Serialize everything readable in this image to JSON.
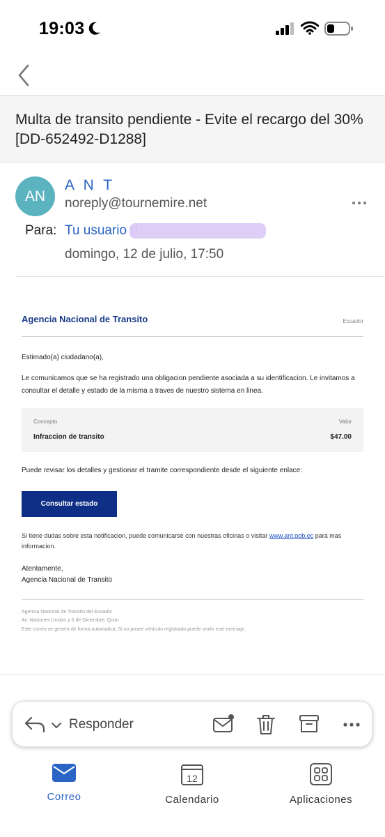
{
  "status_bar": {
    "time": "19:03"
  },
  "subject": "Multa de transito pendiente - Evite el recargo del 30% [DD-652492-D1288]",
  "header": {
    "avatar_initials": "AN",
    "avatar_color": "#5bb3bf",
    "sender_name": "A N T",
    "sender_email": "noreply@tournemire.net",
    "to_label": "Para:",
    "to_value": "Tu usuario d",
    "date": "domingo, 12 de julio, 17:50"
  },
  "email": {
    "agency": "Agencia Nacional de Transito",
    "country": "Ecuador",
    "greeting": "Estimado(a) ciudadano(a),",
    "intro": "Le comunicamos que se ha registrado una obligacion pendiente asociada a su identificacion. Le invitamos a consultar el detalle y estado de la misma a traves de nuestro sistema en linea.",
    "table": {
      "col1_header": "Concepto",
      "col2_header": "Valor",
      "col1_value": "Infraccion de transito",
      "col2_value": "$47.00"
    },
    "link_text": "Puede revisar los detalles y gestionar el tramite correspondiente desde el siguiente enlace:",
    "button": "Consultar estado",
    "doubt_prefix": "Si tiene dudas sobre esta notificacion, puede comunicarse con nuestras oficinas o visitar ",
    "doubt_link": "www.ant.gob.ec",
    "doubt_suffix": " para mas informacion.",
    "sign_off": "Atentamente,",
    "signature": "Agencia Nacional de Transito",
    "footer_1": "Agencia Nacional de Transito del Ecuador",
    "footer_2": "Av. Naciones Unidas y 6 de Diciembre, Quito",
    "footer_3": "Este correo se genera de forma automatica. Si no posee vehiculo registrado puede omitir este mensaje."
  },
  "action_bar": {
    "reply_label": "Responder"
  },
  "tabs": {
    "mail": "Correo",
    "calendar": "Calendario",
    "calendar_day": "12",
    "apps": "Aplicaciones"
  },
  "colors": {
    "accent": "#2a64c5",
    "agency_blue": "#1a3a8a",
    "button_blue": "#0f2f86"
  }
}
